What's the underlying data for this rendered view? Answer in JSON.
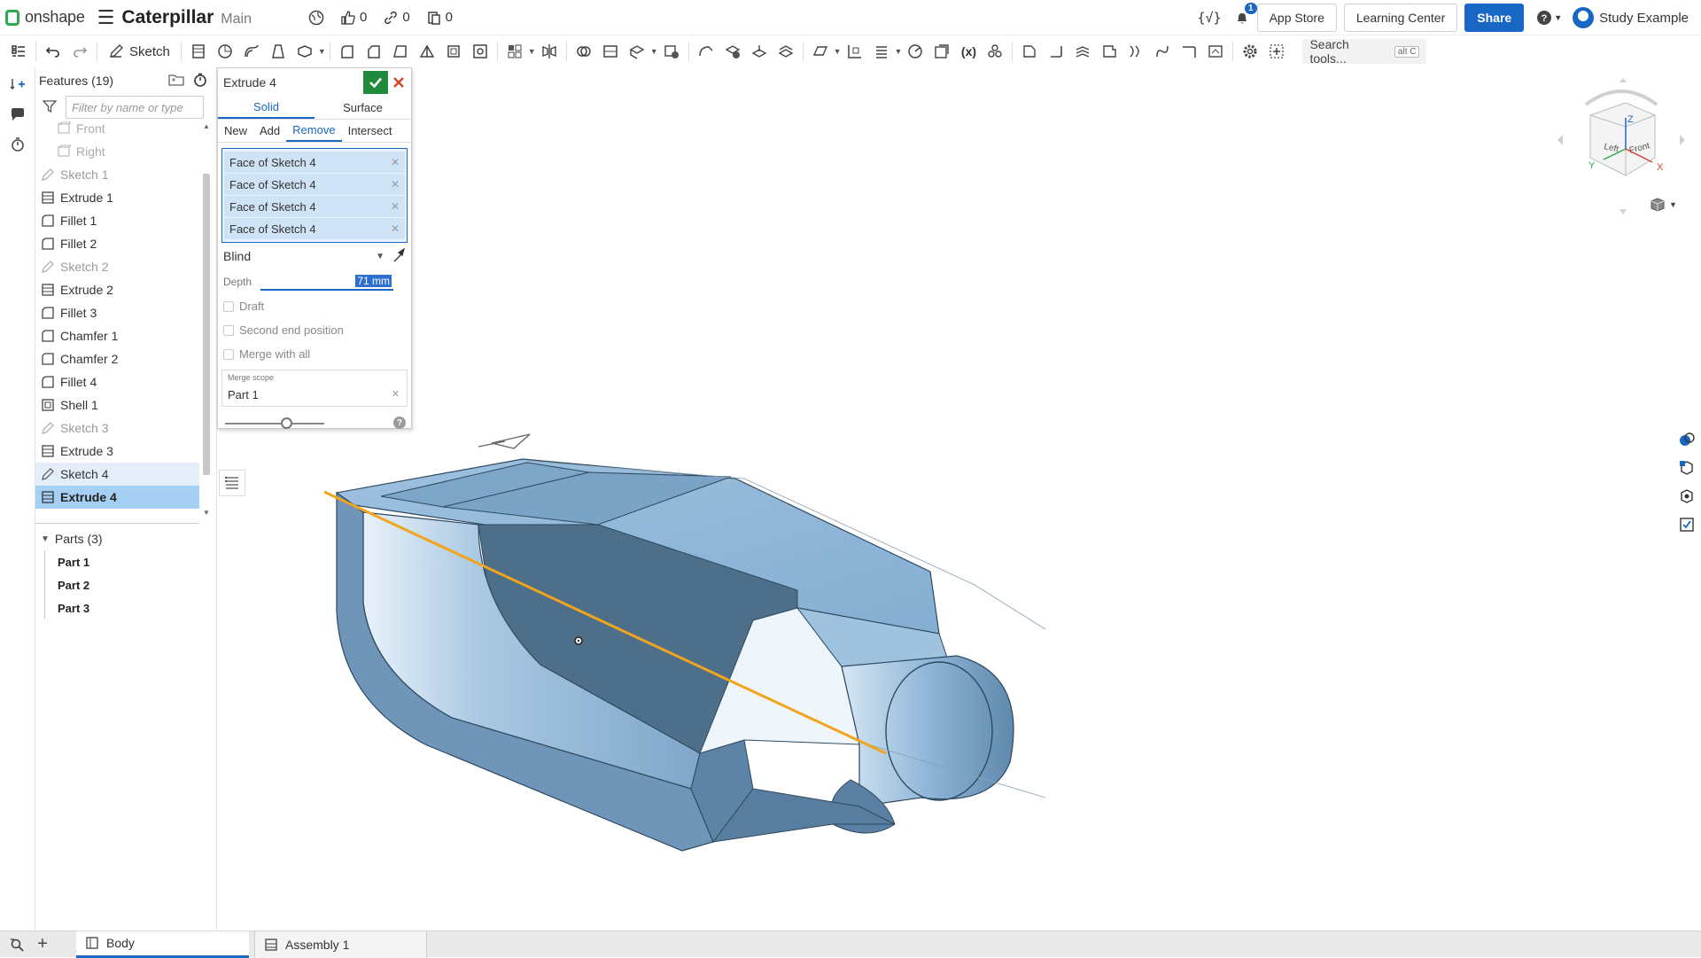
{
  "app": {
    "brand": "onshape",
    "doc_title": "Caterpillar",
    "branch": "Main"
  },
  "stats": {
    "likes": "0",
    "links": "0",
    "copies": "0"
  },
  "top_right": {
    "notifications_count": "1",
    "app_store": "App Store",
    "learning_center": "Learning Center",
    "share": "Share",
    "user": "Study Example"
  },
  "toolbar": {
    "sketch_label": "Sketch",
    "search_tools": "Search tools...",
    "search_shortcut": "alt C"
  },
  "feature_tree": {
    "header": "Features (19)",
    "filter_placeholder": "Filter by name or type",
    "items": [
      {
        "label": "Front",
        "kind": "plane"
      },
      {
        "label": "Right",
        "kind": "plane"
      },
      {
        "label": "Sketch 1",
        "kind": "sketch"
      },
      {
        "label": "Extrude 1",
        "kind": "extrude"
      },
      {
        "label": "Fillet 1",
        "kind": "fillet"
      },
      {
        "label": "Fillet 2",
        "kind": "fillet"
      },
      {
        "label": "Sketch 2",
        "kind": "sketch"
      },
      {
        "label": "Extrude 2",
        "kind": "extrude"
      },
      {
        "label": "Fillet 3",
        "kind": "fillet"
      },
      {
        "label": "Chamfer 1",
        "kind": "chamfer"
      },
      {
        "label": "Chamfer 2",
        "kind": "chamfer"
      },
      {
        "label": "Fillet 4",
        "kind": "fillet"
      },
      {
        "label": "Shell 1",
        "kind": "shell"
      },
      {
        "label": "Sketch 3",
        "kind": "sketch"
      },
      {
        "label": "Extrude 3",
        "kind": "extrude"
      },
      {
        "label": "Sketch 4",
        "kind": "sketch-active"
      },
      {
        "label": "Extrude 4",
        "kind": "extrude-selected"
      }
    ],
    "parts_header": "Parts (3)",
    "parts": [
      "Part 1",
      "Part 2",
      "Part 3"
    ]
  },
  "dialog": {
    "title": "Extrude 4",
    "tabs": [
      "Solid",
      "Surface"
    ],
    "active_tab": "Solid",
    "operations": [
      "New",
      "Add",
      "Remove",
      "Intersect"
    ],
    "active_operation": "Remove",
    "selections": [
      "Face of Sketch 4",
      "Face of Sketch 4",
      "Face of Sketch 4",
      "Face of Sketch 4"
    ],
    "end_type": "Blind",
    "depth_label": "Depth",
    "depth_value": "71 mm",
    "checkboxes": [
      "Draft",
      "Second end position",
      "Merge with all"
    ],
    "merge_scope_label": "Merge scope",
    "merge_scope_value": "Part 1",
    "opacity_slider": 0.62
  },
  "navcube": {
    "top": "Z",
    "left_face": "Left",
    "front_face": "Front",
    "axis_y": "Y",
    "axis_x": "X"
  },
  "bottom_tabs": {
    "active": "Body",
    "other": "Assembly 1"
  },
  "colors": {
    "accent": "#1967c4",
    "ok": "#1f8a3b",
    "cancel": "#d9412b",
    "model_face": "#8db4d6",
    "model_dark": "#4e6f8a",
    "edge_highlight": "#f2a51c"
  }
}
